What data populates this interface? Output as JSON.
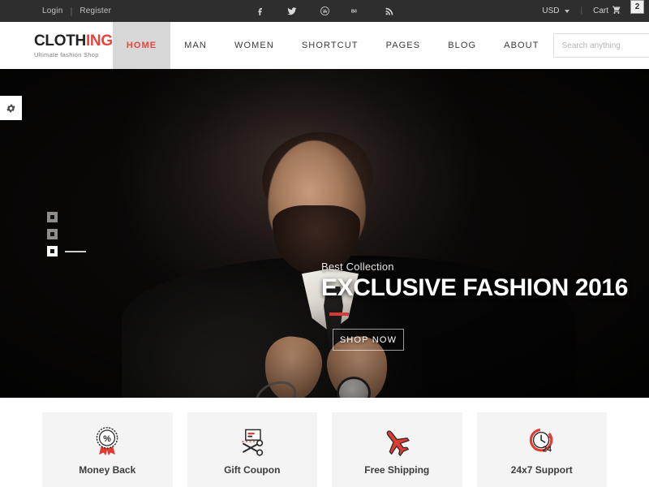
{
  "topbar": {
    "login": "Login",
    "separator": "|",
    "register": "Register",
    "social": [
      {
        "name": "facebook-icon",
        "label": "f"
      },
      {
        "name": "twitter-icon",
        "label": "twitter"
      },
      {
        "name": "wordpress-icon",
        "label": "wordpress"
      },
      {
        "name": "behance-icon",
        "label": "Bē"
      },
      {
        "name": "rss-icon",
        "label": "rss"
      }
    ],
    "currency": "USD",
    "divider": "|",
    "cart_label": "Cart",
    "cart_count": "2"
  },
  "header": {
    "logo_dark": "CLOTH",
    "logo_red": "ING",
    "logo_tagline": "Ultimate fashion Shop",
    "nav": [
      {
        "label": "HOME",
        "active": true
      },
      {
        "label": "MAN",
        "active": false
      },
      {
        "label": "WOMEN",
        "active": false
      },
      {
        "label": "SHORTCUT",
        "active": false
      },
      {
        "label": "PAGES",
        "active": false
      },
      {
        "label": "BLOG",
        "active": false
      },
      {
        "label": "ABOUT",
        "active": false
      }
    ],
    "search_placeholder": "Search anything",
    "search_value": ""
  },
  "hero": {
    "subtitle": "Best Collection",
    "title": "EXCLUSIVE FASHION 2016",
    "button": "SHOP NOW",
    "slides": [
      {
        "index": "1",
        "active": false
      },
      {
        "index": "2",
        "active": false
      },
      {
        "index": "3",
        "active": true
      }
    ]
  },
  "features": [
    {
      "label": "Money Back",
      "icon": "money-back-badge-icon"
    },
    {
      "label": "Gift Coupon",
      "icon": "gift-coupon-scissors-icon"
    },
    {
      "label": "Free Shipping",
      "icon": "airplane-icon"
    },
    {
      "label": "24x7 Support",
      "icon": "clock-24-support-icon"
    }
  ],
  "colors": {
    "accent_red": "#e8453c",
    "topbar_bg": "#2e2e2e",
    "nav_active_bg": "#d7d7d7",
    "feature_bg": "#f4f4f4"
  }
}
